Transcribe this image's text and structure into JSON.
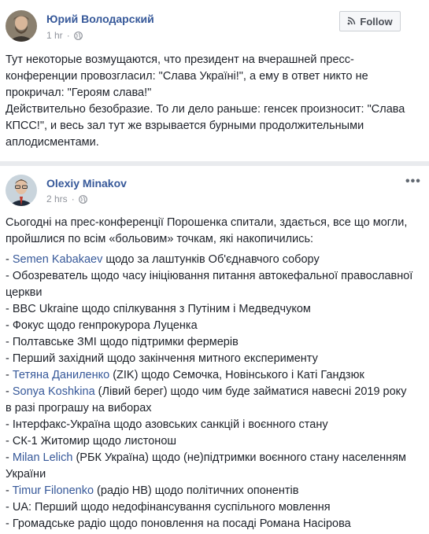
{
  "post1": {
    "author": "Юрий Володарский",
    "time": "1 hr",
    "separator": "·",
    "follow_label": "Follow",
    "more_label": "•••",
    "paragraphs": [
      "Тут некоторые возмущаются, что президент на вчерашней пресс-конференции провозгласил: \"Слава Україні!\", а ему в ответ никто не прокричал: \"Героям слава!\"",
      "Действительно безобразие. То ли дело раньше: генсек произносит: \"Слава КПСС!\", и весь зал тут же взрывается бурными продолжительными аплодисментами."
    ]
  },
  "post2": {
    "author": "Olexiy Minakov",
    "time": "2 hrs",
    "separator": "·",
    "more_label": "•••",
    "intro": "Сьогодні на прес-конференції Порошенка спитали, здається, все що могли, пройшлися по всім «больовим» точкам, які накопичились:",
    "items": [
      {
        "prefix": "- ",
        "link": "Semen Kabakaev",
        "rest": " щодо за лаштунків Об'єднавчого собору"
      },
      {
        "prefix": "- Обозреватель щодо часу ініціювання питання автокефальної православної церкви",
        "link": "",
        "rest": ""
      },
      {
        "prefix": "- BBC Ukraine щодо спілкування з Путіним і Медведчуком",
        "link": "",
        "rest": ""
      },
      {
        "prefix": "- Фокус щодо генпрокурора Луценка",
        "link": "",
        "rest": ""
      },
      {
        "prefix": "- Полтавське ЗМІ щодо підтримки фермерів",
        "link": "",
        "rest": ""
      },
      {
        "prefix": "- Перший західний щодо закінчення митного експерименту",
        "link": "",
        "rest": ""
      },
      {
        "prefix": "- ",
        "link": "Тетяна Даниленко",
        "rest": " (ZIK) щодо Семочка, Новінського і Каті Гандзюк"
      },
      {
        "prefix": "- ",
        "link": "Sonya Koshkina",
        "rest": " (Лівий берег) щодо чим буде займатися навесні 2019 року в разі програшу на виборах"
      },
      {
        "prefix": "- Інтерфакс-Україна щодо азовських санкцій і воєнного стану",
        "link": "",
        "rest": ""
      },
      {
        "prefix": "- СК-1 Житомир щодо листонош",
        "link": "",
        "rest": ""
      },
      {
        "prefix": "- ",
        "link": "Milan Lelich",
        "rest": " (РБК Україна) щодо (не)підтримки воєнного стану населенням України"
      },
      {
        "prefix": "- ",
        "link": "Timur Filonenko",
        "rest": " (радіо НВ) щодо політичних опонентів"
      },
      {
        "prefix": "- UA: Перший щодо недофінансування суспільного мовлення",
        "link": "",
        "rest": ""
      },
      {
        "prefix": "- Громадське радіо щодо поновлення на посаді Романа Насірова",
        "link": "",
        "rest": ""
      }
    ]
  },
  "colors": {
    "link": "#365899",
    "meta": "#90949c",
    "divider": "#e9ebee"
  }
}
